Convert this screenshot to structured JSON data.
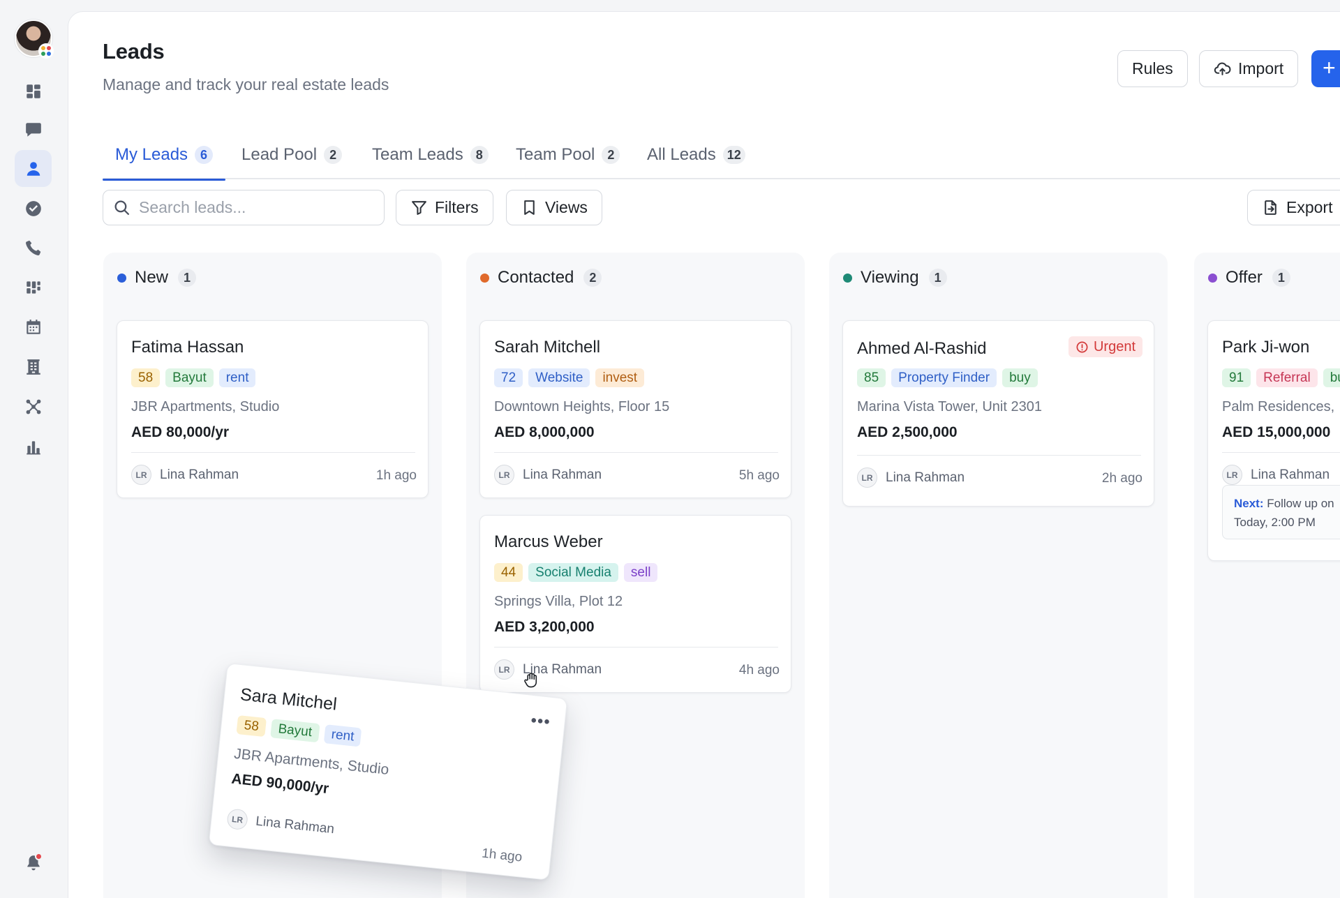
{
  "header": {
    "title": "Leads",
    "subtitle": "Manage and track your real estate leads",
    "rules_label": "Rules",
    "import_label": "Import",
    "add_label": "+"
  },
  "tabs": [
    {
      "label": "My Leads",
      "count": "6",
      "active": true
    },
    {
      "label": "Lead Pool",
      "count": "2"
    },
    {
      "label": "Team Leads",
      "count": "8"
    },
    {
      "label": "Team Pool",
      "count": "2"
    },
    {
      "label": "All Leads",
      "count": "12"
    }
  ],
  "toolbar": {
    "search_placeholder": "Search leads...",
    "filters_label": "Filters",
    "views_label": "Views",
    "export_label": "Export"
  },
  "columns": [
    {
      "title": "New",
      "count": "1",
      "color": "#2b5fd9",
      "cards": [
        {
          "name": "Fatima Hassan",
          "score": "58",
          "source": "Bayut",
          "type": "rent",
          "address": "JBR Apartments, Studio",
          "price": "AED 80,000/yr",
          "owner_initials": "LR",
          "owner": "Lina Rahman",
          "time": "1h ago"
        }
      ]
    },
    {
      "title": "Contacted",
      "count": "2",
      "color": "#e06a2b",
      "cards": [
        {
          "name": "Sarah Mitchell",
          "score": "72",
          "source": "Website",
          "type": "invest",
          "address": "Downtown Heights, Floor 15",
          "price": "AED 8,000,000",
          "owner_initials": "LR",
          "owner": "Lina Rahman",
          "time": "5h ago"
        },
        {
          "name": "Marcus Weber",
          "score": "44",
          "source": "Social Media",
          "type": "sell",
          "address": "Springs Villa, Plot 12",
          "price": "AED 3,200,000",
          "owner_initials": "LR",
          "owner": "Lina Rahman",
          "time": "4h ago"
        }
      ]
    },
    {
      "title": "Viewing",
      "count": "1",
      "color": "#1f8a76",
      "cards": [
        {
          "name": "Ahmed Al-Rashid",
          "badge": "Urgent",
          "score": "85",
          "source": "Property Finder",
          "type": "buy",
          "address": "Marina Vista Tower, Unit 2301",
          "price": "AED 2,500,000",
          "owner_initials": "LR",
          "owner": "Lina Rahman",
          "time": "2h ago"
        }
      ]
    },
    {
      "title": "Offer",
      "count": "1",
      "color": "#8b4fd1",
      "cards": [
        {
          "name": "Park Ji-won",
          "score": "91",
          "source": "Referral",
          "type": "bu",
          "address": "Palm Residences,",
          "price": "AED 15,000,000",
          "owner_initials": "LR",
          "owner": "Lina Rahman",
          "next_label": "Next:",
          "next_text": "Follow up on",
          "next_time": "Today, 2:00 PM"
        }
      ]
    }
  ],
  "drag_card": {
    "name": "Sara Mitchel",
    "score": "58",
    "source": "Bayut",
    "type": "rent",
    "address": "JBR Apartments, Studio",
    "price": "AED 90,000/yr",
    "owner_initials": "LR",
    "owner": "Lina Rahman",
    "time": "1h ago",
    "menu": "•••"
  },
  "icons": {
    "rail": [
      "dashboard-icon",
      "chat-icon",
      "user-icon",
      "check-circle-icon",
      "phone-icon",
      "kanban-icon",
      "calendar-icon",
      "building-icon",
      "network-icon",
      "bar-chart-icon",
      "bell-icon"
    ]
  },
  "colors": {
    "accent": "#2563eb",
    "notification": "#e5484d"
  }
}
